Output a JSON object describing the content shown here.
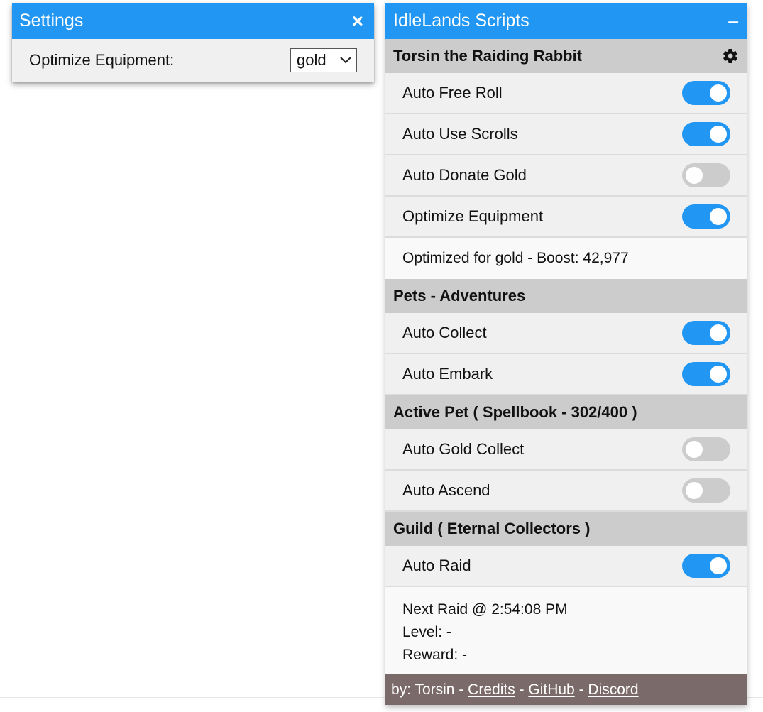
{
  "settings": {
    "title": "Settings",
    "close_icon": "×",
    "optimize_label": "Optimize Equipment:",
    "optimize_value": "gold"
  },
  "panel": {
    "title": "IdleLands Scripts",
    "minimize_icon": "–"
  },
  "character": {
    "name": "Torsin the Raiding Rabbit",
    "toggles": [
      {
        "label": "Auto Free Roll",
        "on": true
      },
      {
        "label": "Auto Use Scrolls",
        "on": true
      },
      {
        "label": "Auto Donate Gold",
        "on": false
      },
      {
        "label": "Optimize Equipment",
        "on": true
      }
    ],
    "optimized_info": "Optimized for gold - Boost: 42,977"
  },
  "pets_adventures": {
    "title": "Pets - Adventures",
    "toggles": [
      {
        "label": "Auto Collect",
        "on": true
      },
      {
        "label": "Auto Embark",
        "on": true
      }
    ]
  },
  "active_pet": {
    "title": "Active Pet ( Spellbook - 302/400 )",
    "toggles": [
      {
        "label": "Auto Gold Collect",
        "on": false
      },
      {
        "label": "Auto Ascend",
        "on": false
      }
    ]
  },
  "guild": {
    "title": "Guild ( Eternal Collectors )",
    "toggles": [
      {
        "label": "Auto Raid",
        "on": true
      }
    ],
    "next_raid": "Next Raid @ 2:54:08 PM",
    "level": "Level: -",
    "reward": "Reward: -"
  },
  "footer": {
    "by": "by: Torsin",
    "sep": " - ",
    "credits": "Credits",
    "github": "GitHub",
    "discord": "Discord"
  },
  "colors": {
    "accent": "#2196f3",
    "section_bg": "#cccccc",
    "footer_bg": "#7b6a6a",
    "toggle_off": "#cccccc"
  }
}
